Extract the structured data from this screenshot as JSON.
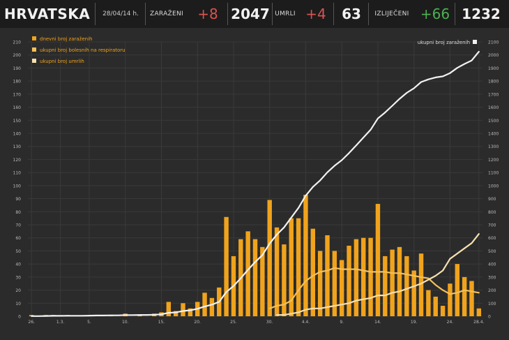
{
  "header": {
    "country": "HRVATSKA",
    "date": "28/04/14 h.",
    "cases_label": "ZARAŽENI",
    "cases_delta": "+8",
    "cases_total": "2047",
    "deaths_label": "UMRLI",
    "deaths_delta": "+4",
    "deaths_total": "63",
    "recovered_label": "IZLIJEČENI",
    "recovered_delta": "+66",
    "recovered_total": "1232"
  },
  "colors": {
    "bars": "#f0a31c",
    "respirator_line": "#f5c05a",
    "deaths_line": "#f6e0b0",
    "cumulative_line": "#f2f2f2",
    "background": "#2b2b2b",
    "grid": "#3a3a3a",
    "header": "#1c1c1c"
  },
  "chart_data": {
    "type": "bar",
    "legend": [
      {
        "label": "dnevni broj zaraženih",
        "color": "#f0a31c"
      },
      {
        "label": "ukupni broj bolesnih na respiratoru",
        "color": "#f5c05a"
      },
      {
        "label": "ukupni broj umrlih",
        "color": "#f6e0b0"
      }
    ],
    "right_legend": "ukupni broj zaraženih",
    "legend_position": "top-left",
    "grid": true,
    "x_ticks": [
      {
        "label": "26.",
        "index": 0
      },
      {
        "label": "1.3.",
        "index": 4
      },
      {
        "label": "5.",
        "index": 8
      },
      {
        "label": "10.",
        "index": 13
      },
      {
        "label": "15.",
        "index": 18
      },
      {
        "label": "20.",
        "index": 23
      },
      {
        "label": "25.",
        "index": 28
      },
      {
        "label": "30.",
        "index": 33
      },
      {
        "label": "4.4.",
        "index": 38
      },
      {
        "label": "9.",
        "index": 43
      },
      {
        "label": "14.",
        "index": 48
      },
      {
        "label": "19.",
        "index": 53
      },
      {
        "label": "24.",
        "index": 58
      },
      {
        "label": "28.4.",
        "index": 62
      }
    ],
    "left_axis": {
      "ylim": [
        0,
        210
      ],
      "ticks": [
        0,
        10,
        20,
        30,
        40,
        50,
        60,
        70,
        80,
        90,
        100,
        110,
        120,
        130,
        140,
        150,
        160,
        170,
        180,
        190,
        200,
        210
      ]
    },
    "right_axis": {
      "ylim": [
        0,
        2100
      ],
      "ticks": [
        0,
        100,
        200,
        300,
        400,
        500,
        600,
        700,
        800,
        900,
        1000,
        1100,
        1200,
        1300,
        1400,
        1500,
        1600,
        1700,
        1800,
        1900,
        2000,
        2100
      ]
    },
    "days": 63,
    "series": [
      {
        "name": "dnevni broj zaraženih",
        "kind": "bar",
        "axis": "left",
        "values": [
          1,
          0,
          1,
          1,
          0,
          1,
          0,
          0,
          0,
          0,
          0,
          1,
          0,
          2,
          0,
          1,
          0,
          2,
          3,
          11,
          4,
          10,
          6,
          11,
          18,
          14,
          22,
          76,
          46,
          59,
          65,
          59,
          53,
          89,
          68,
          55,
          75,
          75,
          93,
          67,
          50,
          62,
          50,
          43,
          54,
          59,
          60,
          60,
          86,
          46,
          51,
          53,
          46,
          35,
          48,
          20,
          15,
          8,
          25,
          40,
          30,
          27,
          6
        ]
      },
      {
        "name": "ukupni broj bolesnih na respiratoru",
        "kind": "line",
        "axis": "left",
        "values": [
          null,
          null,
          null,
          null,
          null,
          null,
          null,
          null,
          null,
          null,
          null,
          null,
          null,
          null,
          null,
          null,
          null,
          null,
          null,
          null,
          null,
          null,
          null,
          null,
          null,
          null,
          null,
          null,
          null,
          null,
          null,
          null,
          null,
          6,
          8,
          9,
          12,
          20,
          27,
          31,
          34,
          35,
          37,
          36,
          36,
          36,
          35,
          34,
          34,
          34,
          33,
          33,
          32,
          31,
          30,
          29,
          24,
          20,
          17,
          18,
          20,
          19,
          18
        ]
      },
      {
        "name": "ukupni broj umrlih",
        "kind": "line",
        "axis": "left",
        "values": [
          null,
          null,
          null,
          null,
          null,
          null,
          null,
          null,
          null,
          null,
          null,
          null,
          null,
          null,
          null,
          null,
          null,
          null,
          null,
          null,
          null,
          null,
          null,
          null,
          null,
          null,
          null,
          null,
          null,
          null,
          null,
          null,
          null,
          null,
          1,
          1,
          2,
          3,
          5,
          6,
          6,
          7,
          8,
          9,
          10,
          12,
          13,
          14,
          16,
          16,
          18,
          19,
          21,
          23,
          25,
          28,
          31,
          35,
          44,
          48,
          52,
          56,
          63
        ]
      },
      {
        "name": "ukupni broj zaraženih",
        "kind": "line",
        "axis": "right",
        "values": [
          1,
          1,
          2,
          3,
          3,
          4,
          4,
          4,
          5,
          6,
          6,
          7,
          7,
          9,
          9,
          10,
          10,
          12,
          15,
          26,
          30,
          40,
          46,
          57,
          75,
          89,
          110,
          186,
          232,
          291,
          356,
          415,
          468,
          557,
          625,
          680,
          755,
          830,
          923,
          990,
          1040,
          1102,
          1152,
          1195,
          1249,
          1308,
          1368,
          1428,
          1514,
          1560,
          1611,
          1664,
          1710,
          1745,
          1793,
          1813,
          1828,
          1836,
          1861,
          1901,
          1931,
          1958,
          2025
        ]
      }
    ]
  }
}
